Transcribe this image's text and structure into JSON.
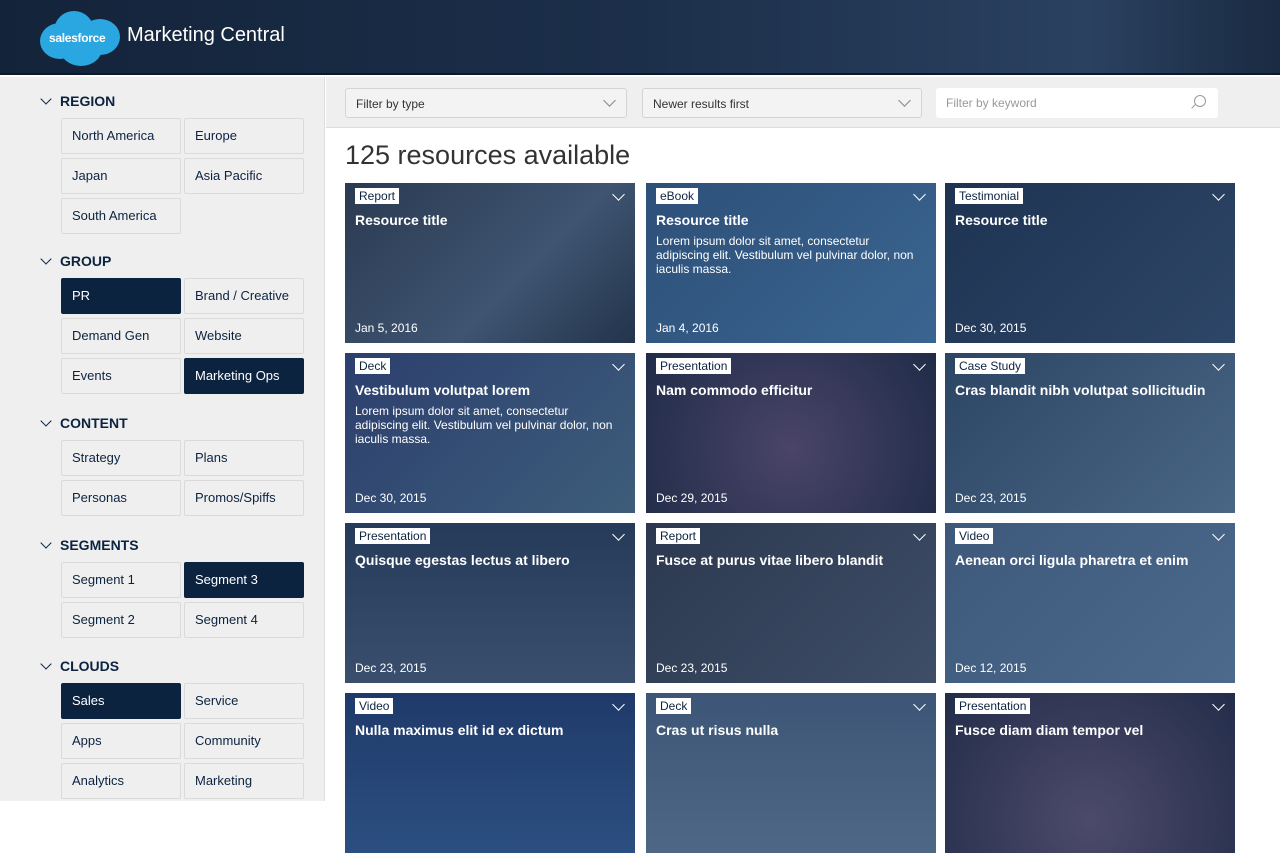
{
  "header": {
    "logo_text": "salesforce",
    "title": "Marketing Central"
  },
  "sidebar": {
    "sections": [
      {
        "title": "REGION",
        "items": [
          {
            "label": "North America",
            "selected": false
          },
          {
            "label": "Europe",
            "selected": false
          },
          {
            "label": "Japan",
            "selected": false
          },
          {
            "label": "Asia Pacific",
            "selected": false
          },
          {
            "label": "South America",
            "selected": false
          }
        ]
      },
      {
        "title": "GROUP",
        "items": [
          {
            "label": "PR",
            "selected": true
          },
          {
            "label": "Brand / Creative",
            "selected": false
          },
          {
            "label": "Demand Gen",
            "selected": false
          },
          {
            "label": "Website",
            "selected": false
          },
          {
            "label": "Events",
            "selected": false
          },
          {
            "label": "Marketing Ops",
            "selected": true
          }
        ]
      },
      {
        "title": "CONTENT",
        "items": [
          {
            "label": "Strategy",
            "selected": false
          },
          {
            "label": "Plans",
            "selected": false
          },
          {
            "label": "Personas",
            "selected": false
          },
          {
            "label": "Promos/Spiffs",
            "selected": false
          }
        ]
      },
      {
        "title": "SEGMENTS",
        "items": [
          {
            "label": "Segment 1",
            "selected": false
          },
          {
            "label": "Segment 3",
            "selected": true
          },
          {
            "label": "Segment 2",
            "selected": false
          },
          {
            "label": "Segment 4",
            "selected": false
          }
        ]
      },
      {
        "title": "CLOUDS",
        "items": [
          {
            "label": "Sales",
            "selected": true
          },
          {
            "label": "Service",
            "selected": false
          },
          {
            "label": "Apps",
            "selected": false
          },
          {
            "label": "Community",
            "selected": false
          },
          {
            "label": "Analytics",
            "selected": false
          },
          {
            "label": "Marketing",
            "selected": false
          }
        ]
      }
    ]
  },
  "toolbar": {
    "type_filter": "Filter by type",
    "sort": "Newer results first",
    "keyword_placeholder": "Filter by keyword"
  },
  "results_count": "125 resources available",
  "cards": [
    {
      "type": "Report",
      "title": "Resource title",
      "desc": "",
      "date": "Jan 5, 2016"
    },
    {
      "type": "eBook",
      "title": "Resource title",
      "desc": "Lorem ipsum dolor sit amet, consectetur adipiscing elit. Vestibulum vel pulvinar dolor, non iaculis massa.",
      "date": "Jan 4, 2016"
    },
    {
      "type": "Testimonial",
      "title": "Resource title",
      "desc": "",
      "date": "Dec 30, 2015"
    },
    {
      "type": "Deck",
      "title": "Vestibulum volutpat lorem",
      "desc": "Lorem ipsum dolor sit amet, consectetur adipiscing elit. Vestibulum vel pulvinar dolor, non iaculis massa.",
      "date": "Dec 30, 2015"
    },
    {
      "type": "Presentation",
      "title": "Nam commodo efficitur",
      "desc": "",
      "date": "Dec 29, 2015"
    },
    {
      "type": "Case Study",
      "title": "Cras blandit nibh volutpat sollicitudin",
      "desc": "",
      "date": "Dec 23, 2015"
    },
    {
      "type": "Presentation",
      "title": "Quisque egestas lectus at libero",
      "desc": "",
      "date": "Dec 23, 2015"
    },
    {
      "type": "Report",
      "title": "Fusce at purus vitae libero blandit",
      "desc": "",
      "date": "Dec 23, 2015"
    },
    {
      "type": "Video",
      "title": "Aenean orci ligula pharetra et enim",
      "desc": "",
      "date": "Dec 12, 2015"
    },
    {
      "type": "Video",
      "title": "Nulla maximus elit id ex dictum",
      "desc": "",
      "date": ""
    },
    {
      "type": "Deck",
      "title": "Cras ut risus nulla",
      "desc": "",
      "date": ""
    },
    {
      "type": "Presentation",
      "title": "Fusce diam diam tempor vel",
      "desc": "",
      "date": ""
    }
  ],
  "colors": {
    "selected": "#0c2340",
    "card_overlay": "#1f3a5f"
  }
}
